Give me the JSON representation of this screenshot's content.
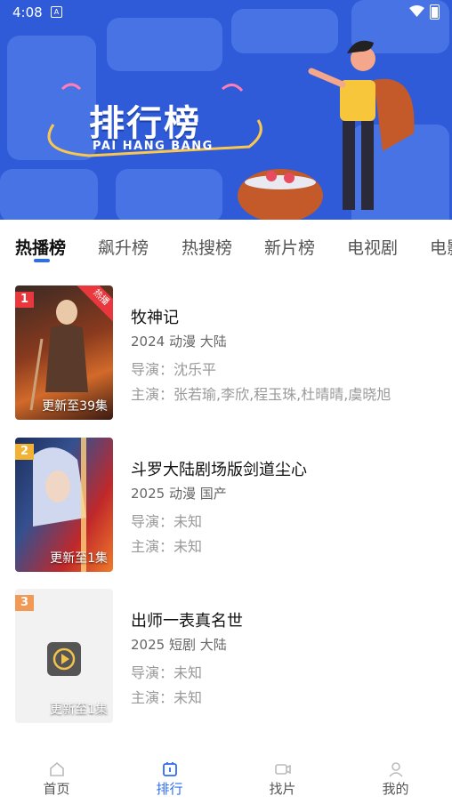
{
  "status_bar": {
    "time": "4:08",
    "app_icon": "A"
  },
  "banner": {
    "title": "排行榜",
    "subtitle": "PAI HANG BANG"
  },
  "tabs": [
    "热播榜",
    "飙升榜",
    "热搜榜",
    "新片榜",
    "电视剧",
    "电影"
  ],
  "items": [
    {
      "rank": "1",
      "badge": "热播",
      "episode": "更新至39集",
      "title": "牧神记",
      "meta": "2024  动漫  大陆",
      "director": "导演：沈乐平",
      "cast": "主演：张若瑜,李欣,程玉珠,杜晴晴,虞晓旭"
    },
    {
      "rank": "2",
      "episode": "更新至1集",
      "title": "斗罗大陆剧场版剑道尘心",
      "meta": "2025  动漫  国产",
      "director": "导演：未知",
      "cast": "主演：未知"
    },
    {
      "rank": "3",
      "episode": "更新至1集",
      "title": "出师一表真名世",
      "meta": "2025  短剧  大陆",
      "director": "导演：未知",
      "cast": "主演：未知"
    }
  ],
  "nav": [
    "首页",
    "排行",
    "找片",
    "我的"
  ],
  "colors": {
    "accent": "#2e6cf0",
    "banner": "#2f5bd8",
    "rank1": "#e8383d",
    "rank2": "#f2b233",
    "rank3": "#f29a55",
    "hot": "#e8383d"
  }
}
